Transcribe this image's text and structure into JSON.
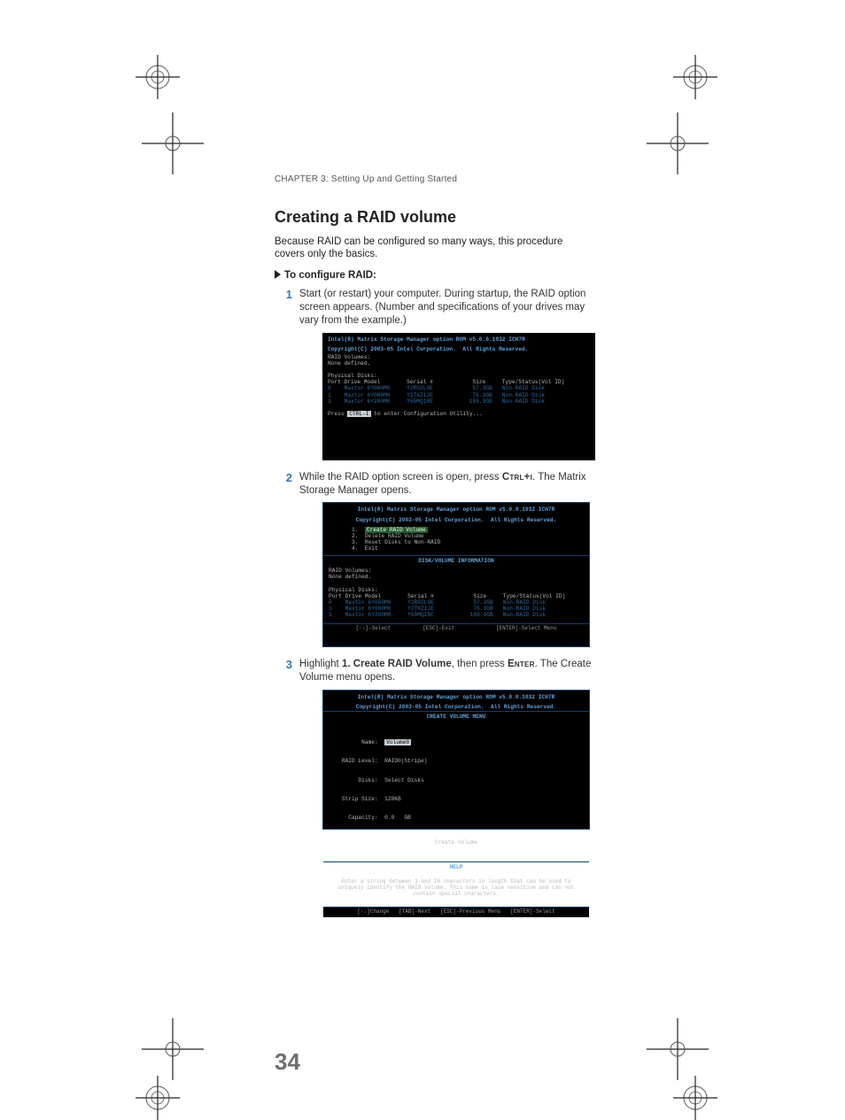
{
  "running_header": {
    "chapter_label": "CHAPTER 3:",
    "chapter_title": " Setting Up and Getting Started"
  },
  "page_number": "34",
  "section_title": "Creating a RAID volume",
  "intro": "Because RAID can be configured so many ways, this procedure covers only the basics.",
  "procedure_heading": "To configure RAID:",
  "steps": [
    {
      "num": "1",
      "text": "Start (or restart) your computer. During startup, the RAID option screen appears. (Number and specifications of your drives may vary from the example.)"
    },
    {
      "num": "2",
      "text_pre": "While the RAID option screen is open, press ",
      "key": "Ctrl+i",
      "text_post": ". The Matrix Storage Manager opens."
    },
    {
      "num": "3",
      "text_pre": "Highlight ",
      "bold": "1. Create RAID Volume",
      "text_mid": ", then press ",
      "key": "Enter",
      "text_post": ". The Create Volume menu opens."
    }
  ],
  "bios1": {
    "header_l1": "Intel(R) Matrix Storage Manager option ROM v5.0.0.1032 ICH7R",
    "header_l2": "Copyright(C) 2003-05 Intel Corporation.  All Rights Reserved.",
    "vol_label": "RAID Volumes:",
    "vol_none": "None defined.",
    "disks_label": "Physical Disks:",
    "cols": "Port Drive Model        Serial #            Size     Type/Status(Vol ID)",
    "rows": [
      "0    Maxtor 6Y060M0     Y2R02L0E            57.3GB   Non-RAID Disk",
      "1    Maxtor 6Y080M0     Y2TKZ1JE            76.3GB   Non-RAID Disk",
      "3    Maxtor 6Y200M0     Y60MQ1RE           189.9GB   Non-RAID Disk"
    ],
    "prompt_pre": "Press ",
    "prompt_key": "CTRL-I",
    "prompt_post": " to enter Configuration Utility..."
  },
  "bios2": {
    "hdr1": "Intel(R) Matrix Storage Manager option ROM v5.0.0.1032 ICH7R",
    "hdr2": "Copyright(C) 2003-05 Intel Corporation.  All Rights Reserved.",
    "menu": [
      {
        "n": "1.",
        "label": "Create RAID Volume",
        "sel": true
      },
      {
        "n": "2.",
        "label": "Delete RAID Volume",
        "sel": false
      },
      {
        "n": "3.",
        "label": "Reset Disks to Non-RAID",
        "sel": false
      },
      {
        "n": "4.",
        "label": "Exit",
        "sel": false
      }
    ],
    "info_label": "DISK/VOLUME INFORMATION",
    "vol_label": "RAID Volumes:",
    "vol_none": "None defined.",
    "disks_label": "Physical Disks:",
    "cols": "Port Drive Model        Serial #            Size     Type/Status(Vol ID)",
    "rows": [
      "0    Maxtor 6Y060M0     Y2R02L0E            57.3GB   Non-RAID Disk",
      "1    Maxtor 6Y080M0     Y2TKZ1JE            76.3GB   Non-RAID Disk",
      "3    Maxtor 6Y200M0     Y60MQ1RE           189.9GB   Non-RAID Disk"
    ],
    "footer": "[↑↓]-Select          [ESC]-Exit             [ENTER]-Select Menu"
  },
  "bios3": {
    "hdr1": "Intel(R) Matrix Storage Manager option ROM v5.0.0.1032 ICH7R",
    "hdr2": "Copyright(C) 2003-05 Intel Corporation.  All Rights Reserved.",
    "panel_label": "CREATE VOLUME MENU",
    "fields": {
      "name_label": "          Name:  ",
      "name_value": "Volume0",
      "raid_label": "    RAID Level:  ",
      "raid_value": "RAID0(Stripe)",
      "disks_label": "         Disks:  ",
      "disks_value": "Select Disks",
      "strip_label": "    Strip Size:  ",
      "strip_value": "128KB",
      "cap_label": "      Capacity:  ",
      "cap_value": "0.0   GB",
      "create": "Create Volume"
    },
    "help_label": "HELP",
    "help_text": "Enter a string between 1 and 16 characters in length that can be used to uniquely identify the RAID volume. This name is case sensitive and can not contain special characters.",
    "footer": "[↑↓]Change   [TAB]-Next   [ESC]-Previous Menu   [ENTER]-Select"
  }
}
